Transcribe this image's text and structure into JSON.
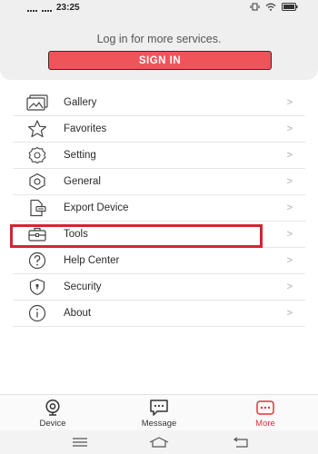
{
  "status_bar": {
    "time": "23:25",
    "battery": "100"
  },
  "header": {
    "login_prompt": "Log in for more services.",
    "sign_in_label": "SIGN IN"
  },
  "menu": {
    "items": [
      {
        "label": "Gallery",
        "icon": "gallery-icon"
      },
      {
        "label": "Favorites",
        "icon": "star-icon"
      },
      {
        "label": "Setting",
        "icon": "gear-icon"
      },
      {
        "label": "General",
        "icon": "hexagon-icon"
      },
      {
        "label": "Export Device",
        "icon": "export-icon"
      },
      {
        "label": "Tools",
        "icon": "toolbox-icon"
      },
      {
        "label": "Help Center",
        "icon": "question-icon"
      },
      {
        "label": "Security",
        "icon": "shield-icon"
      },
      {
        "label": "About",
        "icon": "info-icon"
      }
    ],
    "chevron": ">"
  },
  "tabbar": {
    "tabs": [
      {
        "label": "Device",
        "icon": "camera-icon"
      },
      {
        "label": "Message",
        "icon": "message-icon"
      },
      {
        "label": "More",
        "icon": "more-icon"
      }
    ],
    "active_color": "#e2323c"
  },
  "colors": {
    "accent": "#f0545b",
    "highlight": "#d12632"
  }
}
